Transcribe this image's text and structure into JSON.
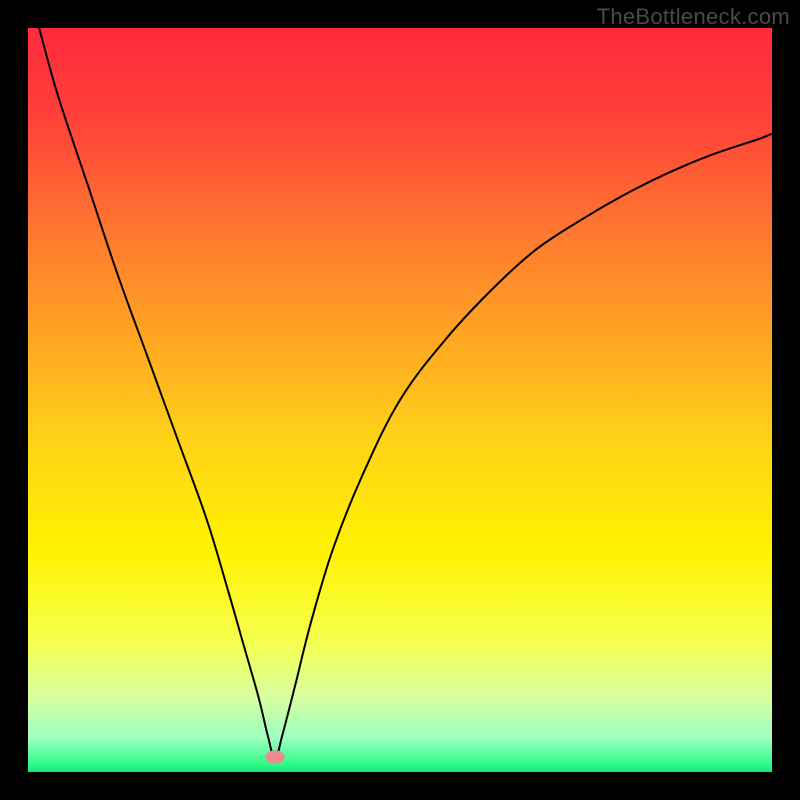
{
  "watermark": "TheBottleneck.com",
  "chart_data": {
    "type": "line",
    "title": "",
    "xlabel": "",
    "ylabel": "",
    "xlim": [
      0,
      100
    ],
    "ylim": [
      0,
      100
    ],
    "grid": false,
    "legend": false,
    "gradient": {
      "stops": [
        {
          "offset": 0.0,
          "color": "#ff2a3c"
        },
        {
          "offset": 0.12,
          "color": "#ff4039"
        },
        {
          "offset": 0.28,
          "color": "#ff7a2f"
        },
        {
          "offset": 0.42,
          "color": "#ffa723"
        },
        {
          "offset": 0.56,
          "color": "#ffd417"
        },
        {
          "offset": 0.7,
          "color": "#fff200"
        },
        {
          "offset": 0.82,
          "color": "#f6ff4a"
        },
        {
          "offset": 0.9,
          "color": "#d8ffa0"
        },
        {
          "offset": 0.955,
          "color": "#9cffc0"
        },
        {
          "offset": 0.99,
          "color": "#2dfc87"
        },
        {
          "offset": 1.0,
          "color": "#18e27d"
        }
      ]
    },
    "green_band": {
      "y_bottom": 0,
      "y_top": 3
    },
    "marker": {
      "x": 33.2,
      "y": 2.0,
      "color": "#e98e8e",
      "rx": 1.3,
      "ry": 0.9
    },
    "series": [
      {
        "name": "curve",
        "color": "#000000",
        "stroke_width": 2,
        "x": [
          1.5,
          4,
          8,
          12,
          16,
          20,
          24,
          27,
          29,
          31,
          32.2,
          33.2,
          34.2,
          36,
          38,
          41,
          45,
          50,
          56,
          62,
          68,
          74,
          80,
          86,
          92,
          98,
          100
        ],
        "y": [
          100,
          91,
          79,
          67,
          56,
          45,
          34,
          24,
          17,
          10,
          5,
          1.8,
          5,
          12,
          20,
          30,
          40,
          50,
          58,
          64.5,
          70,
          74,
          77.5,
          80.5,
          83,
          85,
          85.8
        ]
      }
    ]
  }
}
